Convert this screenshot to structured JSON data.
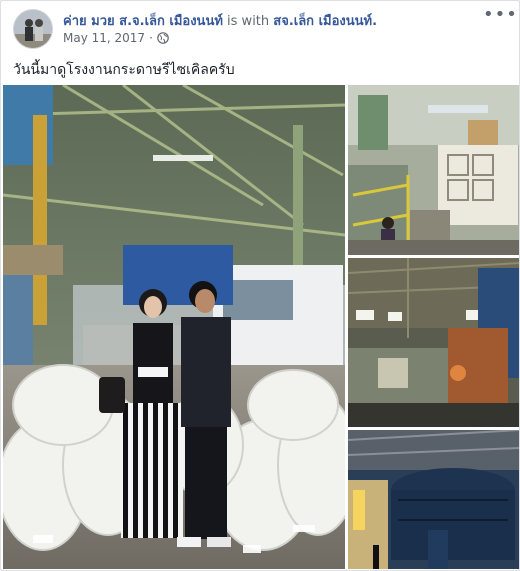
{
  "post": {
    "author": "ค่าย มวย ส.จ.เล็ก เมืองนนท์",
    "joiner": " is with ",
    "tagged": "สจ.เล็ก เมืองนนท์.",
    "date": "May 11, 2017",
    "privacy_icon": "globe-icon",
    "more_label": "•••",
    "caption": "วันนี้มาดูโรงงานกระดาษรีไซเคิลครับ"
  },
  "gallery": {
    "photos": [
      {
        "name": "main-photo",
        "subject": "two people posing in front of recycled paper bales and a truck"
      },
      {
        "name": "machinery-photo",
        "subject": "worker at paper processing machinery"
      },
      {
        "name": "factory-interior-photo",
        "subject": "factory interior with lights"
      },
      {
        "name": "tank-photo",
        "subject": "large industrial tank"
      }
    ]
  },
  "colors": {
    "link": "#365899",
    "text": "#1d2129",
    "meta": "#616770",
    "border": "#dddfe2"
  }
}
